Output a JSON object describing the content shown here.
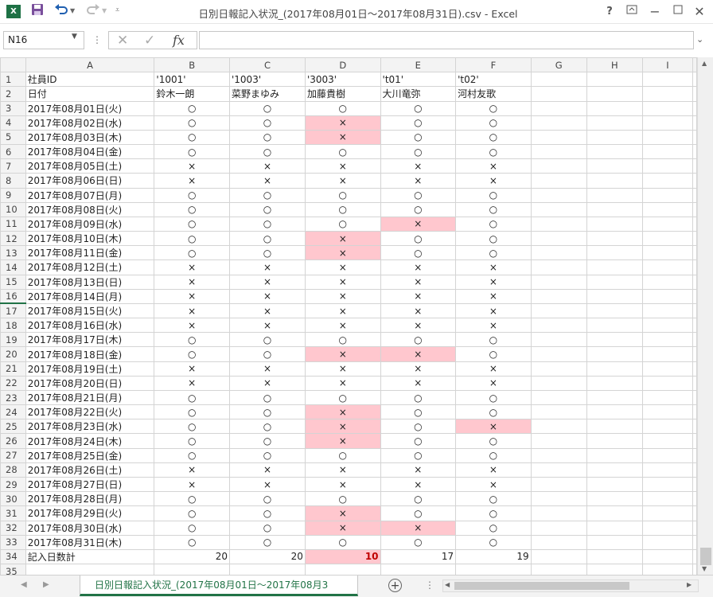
{
  "window": {
    "title": "日別日報記入状況_(2017年08月01日～2017年08月31日).csv - Excel",
    "icons": [
      "excel-logo-icon",
      "save-icon",
      "undo-icon",
      "redo-icon",
      "customize-qat-icon",
      "help-icon",
      "ribbon-display-icon",
      "minimize-icon",
      "maximize-icon",
      "close-icon"
    ]
  },
  "formula_bar": {
    "name_box": "N16",
    "fx_symbol": "fx",
    "value": ""
  },
  "columns": [
    "A",
    "B",
    "C",
    "D",
    "E",
    "F",
    "G",
    "H",
    "I"
  ],
  "active_cell": "N16",
  "active_row": 16,
  "colors": {
    "accent": "#217346",
    "highlight_bg": "#ffc7ce",
    "total_red": "#c00000"
  },
  "sheet": {
    "id_row": [
      "社員ID",
      "'1001'",
      "'1003'",
      "'3003'",
      "'t01'",
      "'t02'"
    ],
    "name_row": [
      "日付",
      "鈴木一朗",
      "菜野まゆみ",
      "加藤貴樹",
      "大川竜弥",
      "河村友歌"
    ],
    "records": [
      {
        "date": "2017年08月01日(火)",
        "marks": [
          "○",
          "○",
          "○",
          "○",
          "○"
        ],
        "hl": []
      },
      {
        "date": "2017年08月02日(水)",
        "marks": [
          "○",
          "○",
          "×",
          "○",
          "○"
        ],
        "hl": [
          2
        ]
      },
      {
        "date": "2017年08月03日(木)",
        "marks": [
          "○",
          "○",
          "×",
          "○",
          "○"
        ],
        "hl": [
          2
        ]
      },
      {
        "date": "2017年08月04日(金)",
        "marks": [
          "○",
          "○",
          "○",
          "○",
          "○"
        ],
        "hl": []
      },
      {
        "date": "2017年08月05日(土)",
        "marks": [
          "×",
          "×",
          "×",
          "×",
          "×"
        ],
        "hl": []
      },
      {
        "date": "2017年08月06日(日)",
        "marks": [
          "×",
          "×",
          "×",
          "×",
          "×"
        ],
        "hl": []
      },
      {
        "date": "2017年08月07日(月)",
        "marks": [
          "○",
          "○",
          "○",
          "○",
          "○"
        ],
        "hl": []
      },
      {
        "date": "2017年08月08日(火)",
        "marks": [
          "○",
          "○",
          "○",
          "○",
          "○"
        ],
        "hl": []
      },
      {
        "date": "2017年08月09日(水)",
        "marks": [
          "○",
          "○",
          "○",
          "×",
          "○"
        ],
        "hl": [
          3
        ]
      },
      {
        "date": "2017年08月10日(木)",
        "marks": [
          "○",
          "○",
          "×",
          "○",
          "○"
        ],
        "hl": [
          2
        ]
      },
      {
        "date": "2017年08月11日(金)",
        "marks": [
          "○",
          "○",
          "×",
          "○",
          "○"
        ],
        "hl": [
          2
        ]
      },
      {
        "date": "2017年08月12日(土)",
        "marks": [
          "×",
          "×",
          "×",
          "×",
          "×"
        ],
        "hl": []
      },
      {
        "date": "2017年08月13日(日)",
        "marks": [
          "×",
          "×",
          "×",
          "×",
          "×"
        ],
        "hl": []
      },
      {
        "date": "2017年08月14日(月)",
        "marks": [
          "×",
          "×",
          "×",
          "×",
          "×"
        ],
        "hl": []
      },
      {
        "date": "2017年08月15日(火)",
        "marks": [
          "×",
          "×",
          "×",
          "×",
          "×"
        ],
        "hl": []
      },
      {
        "date": "2017年08月16日(水)",
        "marks": [
          "×",
          "×",
          "×",
          "×",
          "×"
        ],
        "hl": []
      },
      {
        "date": "2017年08月17日(木)",
        "marks": [
          "○",
          "○",
          "○",
          "○",
          "○"
        ],
        "hl": []
      },
      {
        "date": "2017年08月18日(金)",
        "marks": [
          "○",
          "○",
          "×",
          "×",
          "○"
        ],
        "hl": [
          2,
          3
        ]
      },
      {
        "date": "2017年08月19日(土)",
        "marks": [
          "×",
          "×",
          "×",
          "×",
          "×"
        ],
        "hl": []
      },
      {
        "date": "2017年08月20日(日)",
        "marks": [
          "×",
          "×",
          "×",
          "×",
          "×"
        ],
        "hl": []
      },
      {
        "date": "2017年08月21日(月)",
        "marks": [
          "○",
          "○",
          "○",
          "○",
          "○"
        ],
        "hl": []
      },
      {
        "date": "2017年08月22日(火)",
        "marks": [
          "○",
          "○",
          "×",
          "○",
          "○"
        ],
        "hl": [
          2
        ]
      },
      {
        "date": "2017年08月23日(水)",
        "marks": [
          "○",
          "○",
          "×",
          "○",
          "×"
        ],
        "hl": [
          2,
          4
        ]
      },
      {
        "date": "2017年08月24日(木)",
        "marks": [
          "○",
          "○",
          "×",
          "○",
          "○"
        ],
        "hl": [
          2
        ]
      },
      {
        "date": "2017年08月25日(金)",
        "marks": [
          "○",
          "○",
          "○",
          "○",
          "○"
        ],
        "hl": []
      },
      {
        "date": "2017年08月26日(土)",
        "marks": [
          "×",
          "×",
          "×",
          "×",
          "×"
        ],
        "hl": []
      },
      {
        "date": "2017年08月27日(日)",
        "marks": [
          "×",
          "×",
          "×",
          "×",
          "×"
        ],
        "hl": []
      },
      {
        "date": "2017年08月28日(月)",
        "marks": [
          "○",
          "○",
          "○",
          "○",
          "○"
        ],
        "hl": []
      },
      {
        "date": "2017年08月29日(火)",
        "marks": [
          "○",
          "○",
          "×",
          "○",
          "○"
        ],
        "hl": [
          2
        ]
      },
      {
        "date": "2017年08月30日(水)",
        "marks": [
          "○",
          "○",
          "×",
          "×",
          "○"
        ],
        "hl": [
          2,
          3
        ]
      },
      {
        "date": "2017年08月31日(木)",
        "marks": [
          "○",
          "○",
          "○",
          "○",
          "○"
        ],
        "hl": []
      }
    ],
    "total_label": "記入日数計",
    "totals": [
      "20",
      "20",
      "10",
      "17",
      "19"
    ],
    "total_hl": [
      2
    ]
  },
  "sheet_tab": "日別日報記入状況_(2017年08月01日～2017年08月3"
}
